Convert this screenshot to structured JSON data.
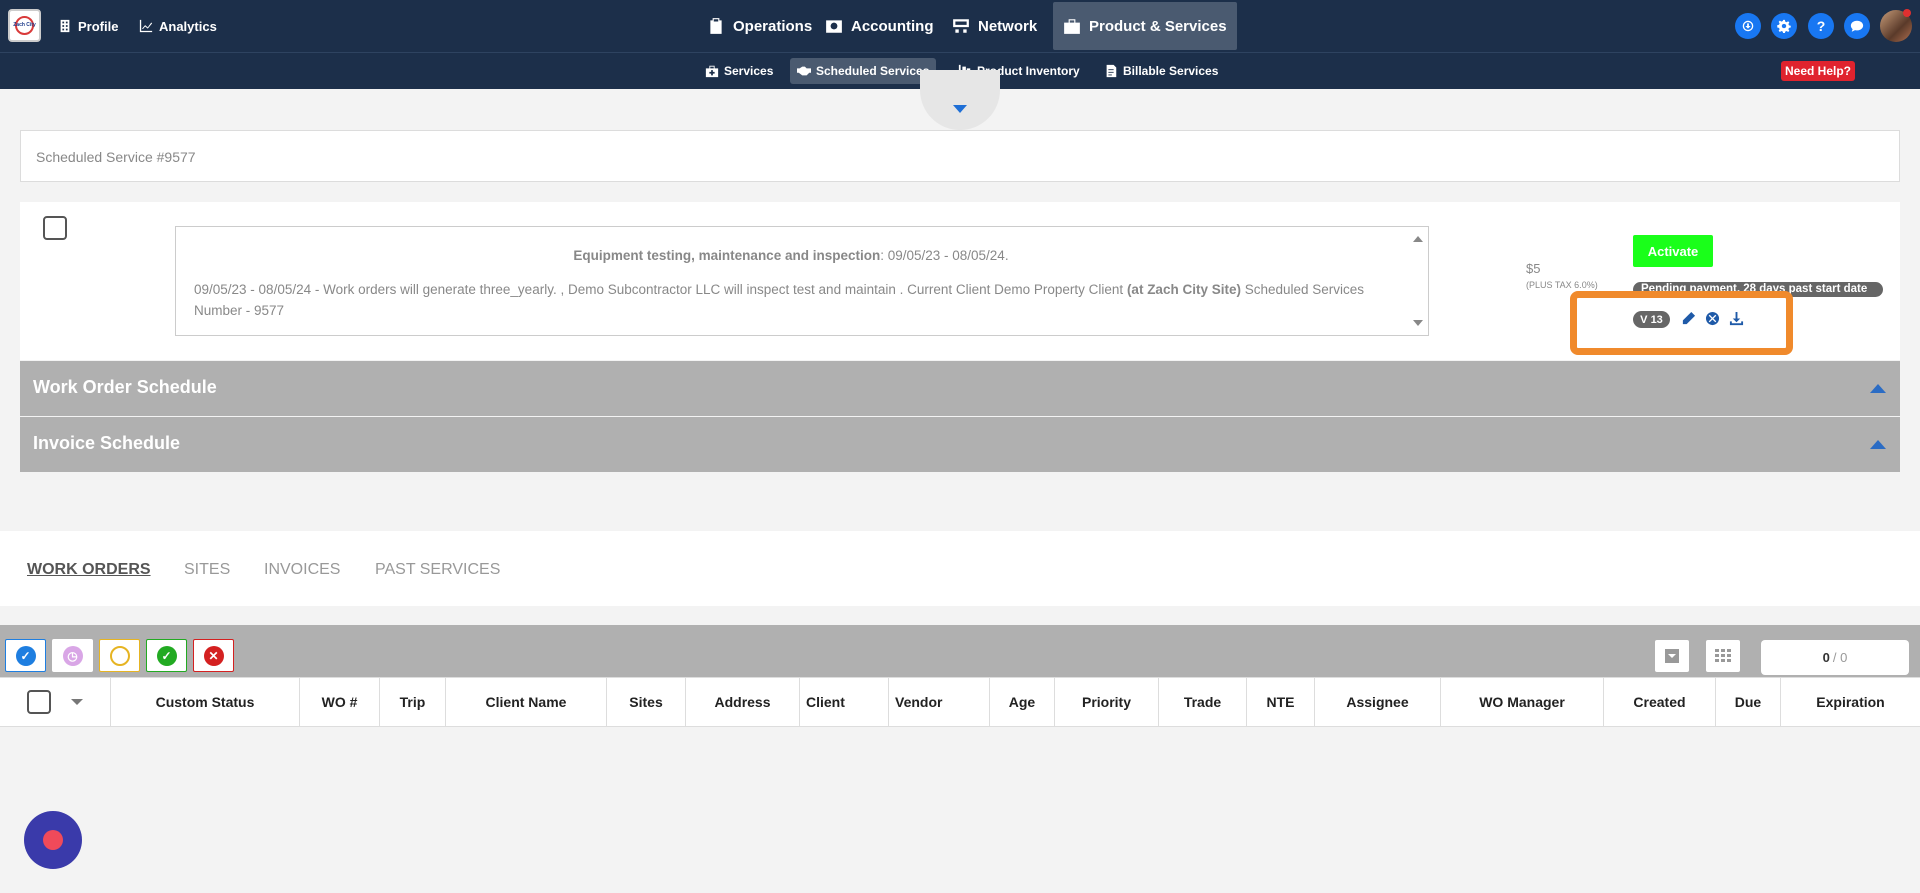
{
  "topnav": {
    "logo_text": "Zach City",
    "left_links": [
      {
        "label": "Profile"
      },
      {
        "label": "Analytics"
      }
    ],
    "main_links": [
      {
        "label": "Operations"
      },
      {
        "label": "Accounting"
      },
      {
        "label": "Network"
      },
      {
        "label": "Product & Services",
        "active": true
      }
    ],
    "right_icons": [
      "download-circle-icon",
      "gear-icon",
      "question-icon",
      "chat-bubble-icon"
    ]
  },
  "subnav": {
    "links": [
      {
        "label": "Services"
      },
      {
        "label": "Scheduled Services",
        "active": true
      },
      {
        "label": "Product Inventory"
      },
      {
        "label": "Billable Services"
      }
    ],
    "need_help": "Need Help?"
  },
  "page": {
    "title": "Scheduled Service #9577"
  },
  "service": {
    "heading_bold": "Equipment testing, maintenance and inspection",
    "heading_rest": ": 09/05/23 - 08/05/24.",
    "body_1": "09/05/23 - 08/05/24 - Work orders will generate three_yearly. , Demo Subcontractor LLC will inspect test and maintain . Current Client Demo Property Client ",
    "body_bold": "(at Zach City Site)",
    "body_2": " Scheduled Services Number - 9577",
    "price": "$5",
    "price_note": "(PLUS TAX 6.0%)",
    "activate_label": "Activate",
    "status": "Pending payment, 28 days past start date",
    "version": "V 13",
    "accent_orange": "#f08a2c"
  },
  "accordions": [
    {
      "label": "Work Order Schedule"
    },
    {
      "label": "Invoice Schedule"
    }
  ],
  "tabs": [
    {
      "label": "WORK ORDERS",
      "active": true
    },
    {
      "label": "SITES"
    },
    {
      "label": "INVOICES"
    },
    {
      "label": "PAST SERVICES"
    }
  ],
  "filters": [
    {
      "name": "all-filter-button",
      "color": "#1e7ee0",
      "glyph": "✓"
    },
    {
      "name": "pending-filter-button",
      "color": "#d9a6e6",
      "glyph": "◷"
    },
    {
      "name": "in-progress-filter-button",
      "color": "#e6b422",
      "glyph": "○"
    },
    {
      "name": "completed-filter-button",
      "color": "#22aa22",
      "glyph": "✓"
    },
    {
      "name": "cancelled-filter-button",
      "color": "#d42020",
      "glyph": "✕"
    }
  ],
  "counter": {
    "current": "0",
    "separator": "/",
    "total": "0"
  },
  "table": {
    "columns": [
      "Custom Status",
      "WO #",
      "Trip",
      "Client Name",
      "Sites",
      "Address",
      "Client",
      "Vendor",
      "Age",
      "Priority",
      "Trade",
      "NTE",
      "Assignee",
      "WO Manager",
      "Created",
      "Due",
      "Expiration"
    ]
  }
}
